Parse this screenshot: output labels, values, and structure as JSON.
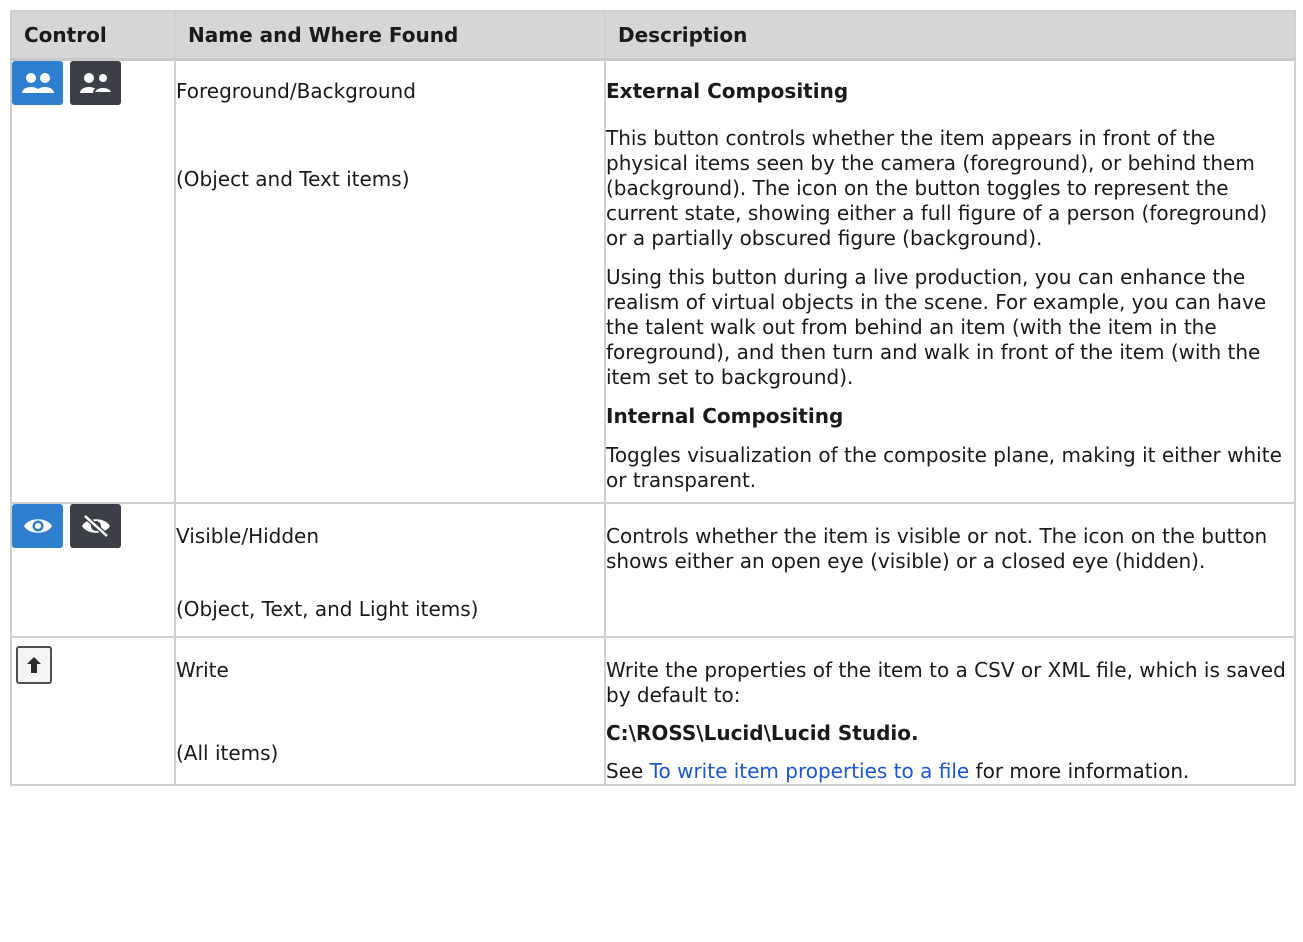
{
  "table": {
    "headers": [
      "Control",
      "Name and Where Found",
      "Description"
    ],
    "rows": [
      {
        "icons": [
          "foreground-people-icon",
          "background-people-icon"
        ],
        "name": "Foreground/Background",
        "where": "(Object and Text items)",
        "desc": {
          "h1": "External Compositing",
          "p1": "This button controls whether the item appears in front of the physical items seen by the camera (foreground), or behind them (background). The icon on the button toggles to represent the current state, showing either a full figure of a person (foreground) or a partially obscured figure (background).",
          "p2": "Using this button during a live production, you can enhance the realism of virtual objects in the scene. For example, you can have the talent walk out from behind an item (with the item in the foreground), and then turn and walk in front of the item (with the item set to background).",
          "h2": "Internal Compositing",
          "p3": "Toggles visualization of the composite plane, making it either white or transparent."
        }
      },
      {
        "icons": [
          "eye-icon",
          "eye-slash-icon"
        ],
        "name": "Visible/Hidden",
        "where": "(Object, Text, and Light items)",
        "desc": {
          "p1": "Controls whether the item is visible or not. The icon on the button shows either an open eye (visible) or a closed eye (hidden)."
        }
      },
      {
        "icons": [
          "upload-arrow-icon"
        ],
        "name": "Write",
        "where": "(All items)",
        "desc": {
          "p1": "Write the properties of the item to a CSV or XML file, which is saved by default to:",
          "path": "C:\\ROSS\\Lucid\\Lucid Studio.",
          "see": "See ",
          "link": "To write item properties to a file",
          "after": " for more information."
        }
      }
    ]
  },
  "colors": {
    "header_bg": "#d6d6d6",
    "icon_blue": "#2f7fd0",
    "icon_dark": "#3c4046",
    "link": "#1a56d6"
  }
}
